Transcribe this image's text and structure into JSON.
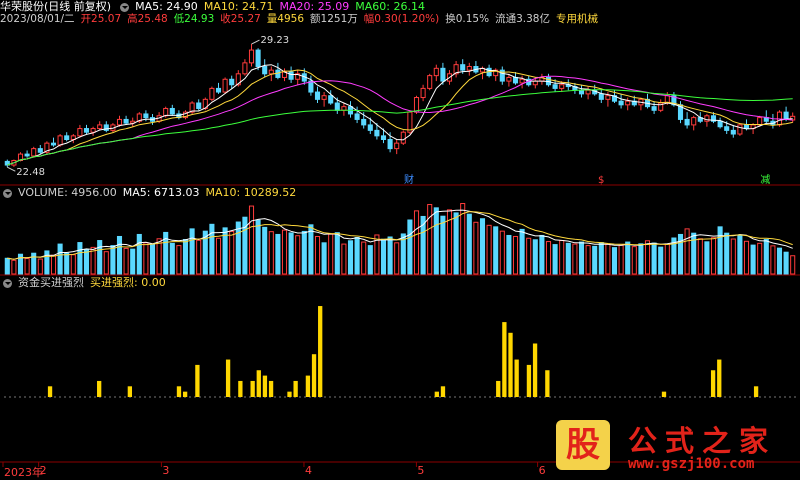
{
  "header": {
    "title": "华荣股份(日线 前复权)",
    "ma": [
      {
        "label": "MA5: 24.90",
        "color": "#ffffff"
      },
      {
        "label": "MA10: 24.71",
        "color": "#ffd93d"
      },
      {
        "label": "MA20: 25.09",
        "color": "#ff3cff"
      },
      {
        "label": "MA60: 26.14",
        "color": "#3cff3c"
      }
    ]
  },
  "quote": {
    "date": "2023/08/01/二",
    "open": "开25.07",
    "high": "高25.48",
    "low": "低24.93",
    "close": "收25.27",
    "volume": "量4956",
    "amount": "额1251万",
    "change": "幅0.30(1.20%)",
    "turnover": "换0.15%",
    "float": "流通3.38亿",
    "sector": "专用机械"
  },
  "price_labels": {
    "high": "29.23",
    "low": "22.48"
  },
  "event_markers": [
    {
      "text": "财",
      "color": "#3c8cff"
    },
    {
      "text": "$",
      "color": "#ff3c3c"
    },
    {
      "text": "减",
      "color": "#3cff3c"
    }
  ],
  "volume_panel": {
    "name": "VOLUME: 4956.00",
    "ma5": "MA5: 6713.03",
    "ma10": "MA10: 10289.52"
  },
  "indicator_panel": {
    "name": "资金买进强烈",
    "value": "买进强烈: 0.00"
  },
  "date_axis": {
    "labels": [
      "2023年",
      "2",
      "3",
      "4",
      "5",
      "6"
    ]
  },
  "watermark": {
    "logo_char": "股",
    "title": "公式之家",
    "url": "www.gszj100.com"
  },
  "colors": {
    "up": "#ff3c3c",
    "down": "#5ad8ff",
    "ma5": "#ffffff",
    "ma10": "#ffd93d",
    "ma20": "#ff3cff",
    "ma60": "#3cff3c",
    "separator": "#8b0000",
    "signal": "#ffd700"
  },
  "chart_data": [
    {
      "type": "candlestick",
      "title": "华荣股份(日线 前复权)",
      "ylim": [
        22.0,
        30.0
      ],
      "annotations": {
        "max": 29.23,
        "min": 22.48
      },
      "ohlc": [
        [
          22.8,
          22.9,
          22.48,
          22.6
        ],
        [
          22.6,
          22.9,
          22.5,
          22.85
        ],
        [
          22.85,
          23.3,
          22.8,
          23.2
        ],
        [
          23.2,
          23.4,
          23.0,
          23.1
        ],
        [
          23.1,
          23.6,
          23.0,
          23.5
        ],
        [
          23.5,
          23.7,
          23.2,
          23.3
        ],
        [
          23.3,
          23.9,
          23.2,
          23.8
        ],
        [
          23.8,
          24.1,
          23.6,
          23.7
        ],
        [
          23.7,
          24.3,
          23.6,
          24.2
        ],
        [
          24.2,
          24.4,
          23.9,
          24.0
        ],
        [
          24.0,
          24.3,
          23.8,
          24.2
        ],
        [
          24.2,
          24.8,
          24.1,
          24.6
        ],
        [
          24.6,
          24.8,
          24.3,
          24.4
        ],
        [
          24.4,
          24.7,
          24.2,
          24.6
        ],
        [
          24.6,
          25.0,
          24.5,
          24.8
        ],
        [
          24.8,
          25.0,
          24.4,
          24.5
        ],
        [
          24.5,
          24.9,
          24.4,
          24.8
        ],
        [
          24.8,
          25.3,
          24.7,
          25.1
        ],
        [
          25.1,
          25.3,
          24.8,
          24.9
        ],
        [
          24.9,
          25.2,
          24.7,
          25.0
        ],
        [
          25.0,
          25.5,
          24.9,
          25.4
        ],
        [
          25.4,
          25.6,
          25.0,
          25.2
        ],
        [
          25.2,
          25.4,
          24.8,
          25.0
        ],
        [
          25.0,
          25.5,
          24.9,
          25.3
        ],
        [
          25.3,
          25.8,
          25.2,
          25.7
        ],
        [
          25.7,
          25.9,
          25.3,
          25.4
        ],
        [
          25.4,
          25.6,
          25.1,
          25.2
        ],
        [
          25.2,
          25.6,
          25.1,
          25.5
        ],
        [
          25.5,
          26.1,
          25.4,
          26.0
        ],
        [
          26.0,
          26.2,
          25.6,
          25.7
        ],
        [
          25.7,
          26.3,
          25.6,
          26.2
        ],
        [
          26.2,
          26.9,
          26.1,
          26.8
        ],
        [
          26.8,
          27.1,
          26.5,
          26.6
        ],
        [
          26.6,
          27.4,
          26.5,
          27.3
        ],
        [
          27.3,
          27.5,
          26.8,
          27.0
        ],
        [
          27.0,
          27.8,
          26.9,
          27.6
        ],
        [
          27.6,
          28.4,
          27.5,
          28.2
        ],
        [
          28.2,
          29.23,
          28.0,
          28.9
        ],
        [
          28.9,
          29.0,
          27.8,
          28.0
        ],
        [
          28.0,
          28.4,
          27.4,
          27.6
        ],
        [
          27.6,
          28.0,
          27.2,
          27.8
        ],
        [
          27.8,
          28.2,
          27.3,
          27.4
        ],
        [
          27.4,
          27.9,
          27.2,
          27.7
        ],
        [
          27.7,
          28.0,
          27.1,
          27.3
        ],
        [
          27.3,
          27.8,
          27.0,
          27.6
        ],
        [
          27.6,
          27.9,
          27.0,
          27.2
        ],
        [
          27.2,
          27.5,
          26.4,
          26.6
        ],
        [
          26.6,
          26.9,
          26.0,
          26.2
        ],
        [
          26.2,
          26.6,
          25.8,
          26.4
        ],
        [
          26.4,
          26.7,
          25.9,
          26.0
        ],
        [
          26.0,
          26.3,
          25.4,
          25.6
        ],
        [
          25.6,
          26.0,
          25.3,
          25.8
        ],
        [
          25.8,
          26.1,
          25.2,
          25.4
        ],
        [
          25.4,
          25.8,
          24.9,
          25.1
        ],
        [
          25.1,
          25.5,
          24.6,
          24.8
        ],
        [
          24.8,
          25.2,
          24.3,
          24.5
        ],
        [
          24.5,
          24.9,
          24.0,
          24.2
        ],
        [
          24.2,
          24.6,
          23.8,
          24.0
        ],
        [
          24.0,
          24.4,
          23.3,
          23.5
        ],
        [
          23.5,
          24.0,
          23.2,
          23.8
        ],
        [
          23.8,
          24.5,
          23.7,
          24.4
        ],
        [
          24.4,
          25.6,
          24.3,
          25.5
        ],
        [
          25.5,
          26.4,
          25.4,
          26.3
        ],
        [
          26.3,
          27.0,
          26.1,
          26.8
        ],
        [
          26.8,
          27.6,
          26.7,
          27.5
        ],
        [
          27.5,
          28.1,
          27.2,
          27.9
        ],
        [
          27.9,
          28.2,
          27.0,
          27.2
        ],
        [
          27.2,
          27.8,
          27.0,
          27.6
        ],
        [
          27.6,
          28.3,
          27.4,
          28.1
        ],
        [
          28.1,
          28.4,
          27.6,
          27.8
        ],
        [
          27.8,
          28.2,
          27.5,
          28.0
        ],
        [
          28.0,
          28.3,
          27.6,
          27.7
        ],
        [
          27.7,
          28.0,
          27.3,
          27.9
        ],
        [
          27.9,
          28.1,
          27.4,
          27.5
        ],
        [
          27.5,
          27.9,
          27.2,
          27.8
        ],
        [
          27.8,
          28.0,
          27.0,
          27.2
        ],
        [
          27.2,
          27.6,
          26.9,
          27.4
        ],
        [
          27.4,
          27.7,
          27.0,
          27.1
        ],
        [
          27.1,
          27.5,
          26.8,
          27.3
        ],
        [
          27.3,
          27.5,
          26.9,
          27.0
        ],
        [
          27.0,
          27.4,
          26.8,
          27.2
        ],
        [
          27.2,
          27.6,
          27.0,
          27.4
        ],
        [
          27.4,
          27.6,
          26.9,
          27.0
        ],
        [
          27.0,
          27.3,
          26.6,
          26.8
        ],
        [
          26.8,
          27.2,
          26.6,
          27.0
        ],
        [
          27.0,
          27.3,
          26.7,
          26.9
        ],
        [
          26.9,
          27.1,
          26.5,
          26.7
        ],
        [
          26.7,
          27.0,
          26.3,
          26.5
        ],
        [
          26.5,
          26.9,
          26.2,
          26.7
        ],
        [
          26.7,
          27.0,
          26.4,
          26.5
        ],
        [
          26.5,
          26.8,
          26.0,
          26.2
        ],
        [
          26.2,
          26.6,
          25.8,
          26.4
        ],
        [
          26.4,
          26.7,
          26.0,
          26.1
        ],
        [
          26.1,
          26.5,
          25.7,
          25.9
        ],
        [
          25.9,
          26.3,
          25.6,
          26.1
        ],
        [
          26.1,
          26.4,
          25.8,
          25.9
        ],
        [
          25.9,
          26.3,
          25.6,
          26.2
        ],
        [
          26.2,
          26.5,
          25.7,
          25.8
        ],
        [
          25.8,
          26.1,
          25.4,
          25.6
        ],
        [
          25.6,
          26.2,
          25.5,
          26.0
        ],
        [
          26.0,
          26.6,
          25.9,
          26.4
        ],
        [
          26.4,
          26.6,
          25.8,
          25.9
        ],
        [
          25.9,
          26.1,
          24.9,
          25.1
        ],
        [
          25.1,
          25.5,
          24.6,
          24.8
        ],
        [
          24.8,
          25.3,
          24.5,
          25.2
        ],
        [
          25.2,
          25.5,
          24.9,
          25.0
        ],
        [
          25.0,
          25.4,
          24.7,
          25.3
        ],
        [
          25.3,
          25.5,
          24.9,
          25.0
        ],
        [
          25.0,
          25.2,
          24.6,
          24.7
        ],
        [
          24.7,
          25.0,
          24.3,
          24.5
        ],
        [
          24.5,
          24.8,
          24.1,
          24.3
        ],
        [
          24.3,
          24.9,
          24.2,
          24.8
        ],
        [
          24.8,
          25.1,
          24.5,
          24.6
        ],
        [
          24.6,
          24.9,
          24.3,
          24.8
        ],
        [
          24.8,
          25.3,
          24.7,
          25.2
        ],
        [
          25.2,
          25.6,
          24.9,
          25.0
        ],
        [
          25.0,
          25.4,
          24.6,
          24.8
        ],
        [
          24.8,
          25.6,
          24.7,
          25.5
        ],
        [
          25.5,
          25.8,
          25.0,
          25.1
        ],
        [
          25.07,
          25.48,
          24.93,
          25.27
        ]
      ]
    },
    {
      "type": "bar",
      "title": "VOLUME",
      "series_name": "VOLUME",
      "values": [
        6200,
        5400,
        7800,
        6100,
        8200,
        5900,
        9100,
        7400,
        11800,
        8200,
        7600,
        12400,
        9600,
        10500,
        13200,
        8800,
        11200,
        14800,
        10100,
        9800,
        15600,
        12300,
        11800,
        13900,
        16400,
        12100,
        11200,
        13600,
        17800,
        13300,
        16900,
        19600,
        14100,
        18200,
        16800,
        20500,
        22400,
        26800,
        21200,
        18400,
        16700,
        15600,
        17300,
        16200,
        15100,
        16800,
        19400,
        14800,
        12300,
        15700,
        16300,
        11800,
        13100,
        14400,
        12600,
        11200,
        15400,
        13700,
        14600,
        12300,
        15800,
        21300,
        24900,
        22700,
        27400,
        26100,
        22800,
        25300,
        24100,
        27800,
        23600,
        20400,
        21800,
        19200,
        18600,
        16900,
        15200,
        14800,
        17600,
        14100,
        13500,
        15200,
        12800,
        11600,
        13200,
        12100,
        11800,
        12600,
        11200,
        10900,
        12400,
        11700,
        10400,
        11300,
        12600,
        10800,
        11900,
        13100,
        12200,
        10600,
        11800,
        14200,
        15600,
        17800,
        16100,
        13900,
        12700,
        14300,
        18600,
        16100,
        13800,
        15200,
        12900,
        11400,
        12100,
        13600,
        11100,
        10200,
        8600,
        7200
      ],
      "down_flags": [
        1,
        0,
        1,
        0,
        1,
        0,
        1,
        0,
        1,
        1,
        0,
        1,
        1,
        0,
        1,
        0,
        1,
        1,
        0,
        1,
        1,
        0,
        1,
        0,
        1,
        1,
        0,
        1,
        1,
        0,
        1,
        1,
        0,
        1,
        0,
        1,
        1,
        0,
        1,
        1,
        0,
        1,
        0,
        1,
        0,
        1,
        1,
        0,
        1,
        0,
        1,
        0,
        1,
        1,
        0,
        1,
        0,
        1,
        1,
        0,
        1,
        1,
        0,
        1,
        0,
        1,
        1,
        0,
        1,
        0,
        1,
        0,
        1,
        0,
        1,
        0,
        1,
        0,
        1,
        0,
        1,
        1,
        0,
        1,
        0,
        1,
        0,
        1,
        0,
        1,
        1,
        0,
        1,
        0,
        1,
        0,
        1,
        0,
        1,
        1,
        0,
        1,
        1,
        0,
        1,
        0,
        1,
        0,
        1,
        1,
        0,
        1,
        0,
        1,
        0,
        1,
        0,
        1,
        1,
        0
      ]
    },
    {
      "type": "bar",
      "title": "资金买进强烈",
      "series_name": "买进强烈",
      "values": [
        0,
        0,
        0,
        0,
        0,
        0,
        0,
        2,
        0,
        0,
        0,
        0,
        0,
        0,
        0,
        3,
        0,
        0,
        0,
        0,
        2,
        0,
        0,
        0,
        0,
        0,
        0,
        0,
        2,
        1,
        0,
        6,
        0,
        0,
        0,
        0,
        7,
        0,
        3,
        0,
        3,
        5,
        4,
        3,
        0,
        0,
        1,
        3,
        0,
        4,
        8,
        17,
        0,
        0,
        0,
        0,
        0,
        0,
        0,
        0,
        0,
        0,
        0,
        0,
        0,
        0,
        0,
        0,
        0,
        0,
        1,
        2,
        0,
        0,
        0,
        0,
        0,
        0,
        0,
        0,
        3,
        14,
        12,
        7,
        0,
        6,
        10,
        0,
        5,
        0,
        0,
        0,
        0,
        0,
        0,
        0,
        0,
        0,
        0,
        0,
        0,
        0,
        0,
        0,
        0,
        0,
        0,
        1,
        0,
        0,
        0,
        0,
        0,
        0,
        0,
        5,
        7,
        0,
        0,
        0,
        0,
        0,
        2,
        0,
        0,
        0,
        0,
        0,
        0
      ],
      "ylim": [
        0,
        20
      ]
    }
  ]
}
